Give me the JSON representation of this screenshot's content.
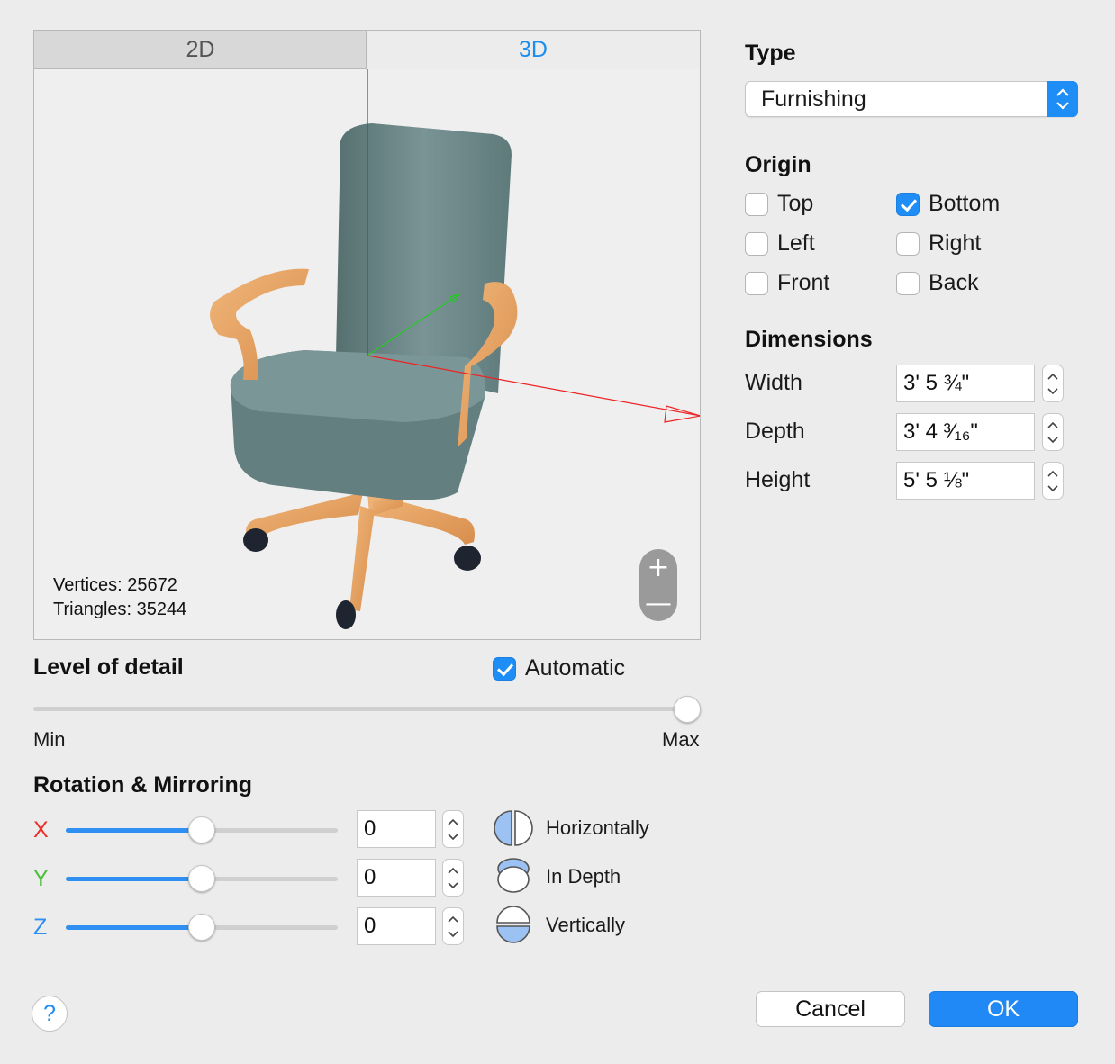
{
  "tabs": [
    {
      "label": "2D",
      "active": false
    },
    {
      "label": "3D",
      "active": true
    }
  ],
  "viewer": {
    "vertices": "Vertices: 25672",
    "triangles": "Triangles: 35244",
    "zoom_in": "+",
    "zoom_out": "—"
  },
  "level_of_detail": {
    "heading": "Level of detail",
    "automatic_label": "Automatic",
    "automatic_checked": true,
    "min_label": "Min",
    "max_label": "Max",
    "value": 1.0
  },
  "rotation": {
    "heading": "Rotation & Mirroring",
    "axes": [
      {
        "label": "X",
        "color": "#e8322b",
        "value": "0",
        "slider": 0.5
      },
      {
        "label": "Y",
        "color": "#4bbf3c",
        "value": "0",
        "slider": 0.5
      },
      {
        "label": "Z",
        "color": "#2e8ff0",
        "value": "0",
        "slider": 0.5
      }
    ],
    "mirror": [
      {
        "label": "Horizontally",
        "icon": "mirror-horizontal-icon"
      },
      {
        "label": "In Depth",
        "icon": "mirror-depth-icon"
      },
      {
        "label": "Vertically",
        "icon": "mirror-vertical-icon"
      }
    ]
  },
  "type": {
    "heading": "Type",
    "value": "Furnishing"
  },
  "origin": {
    "heading": "Origin",
    "options": [
      {
        "label": "Top",
        "checked": false
      },
      {
        "label": "Bottom",
        "checked": true
      },
      {
        "label": "Left",
        "checked": false
      },
      {
        "label": "Right",
        "checked": false
      },
      {
        "label": "Front",
        "checked": false
      },
      {
        "label": "Back",
        "checked": false
      }
    ]
  },
  "dimensions": {
    "heading": "Dimensions",
    "rows": [
      {
        "label": "Width",
        "value": "3' 5 ¾\""
      },
      {
        "label": "Depth",
        "value": "3' 4 ³⁄₁₆\""
      },
      {
        "label": "Height",
        "value": "5' 5 ⅛\""
      }
    ]
  },
  "buttons": {
    "help": "?",
    "cancel": "Cancel",
    "ok": "OK"
  },
  "colors": {
    "accent": "#1e8ef6",
    "chair_fabric": "#6b8587",
    "chair_wood": "#e8a463"
  }
}
